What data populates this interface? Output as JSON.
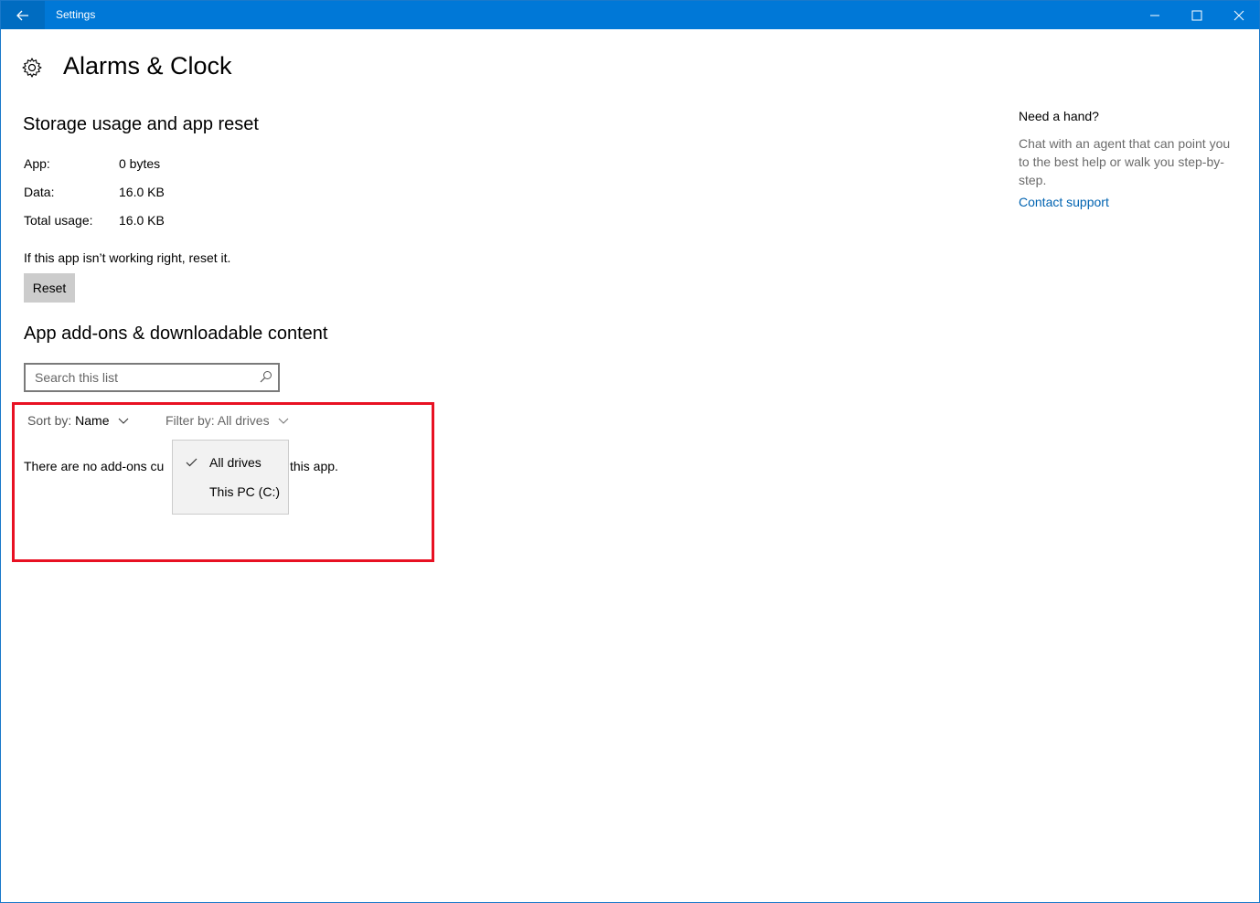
{
  "window": {
    "title": "Settings"
  },
  "page": {
    "title": "Alarms & Clock"
  },
  "storage": {
    "heading": "Storage usage and app reset",
    "rows": [
      {
        "label": "App:",
        "value": "0 bytes"
      },
      {
        "label": "Data:",
        "value": "16.0 KB"
      },
      {
        "label": "Total usage:",
        "value": "16.0 KB"
      }
    ],
    "reset_hint": "If this app isn’t working right, reset it.",
    "reset_label": "Reset"
  },
  "addons": {
    "heading": "App add-ons & downloadable content",
    "search_placeholder": "Search this list",
    "sort_prefix": "Sort by: ",
    "sort_value": "Name",
    "filter_label": "Filter by: All drives",
    "empty_message_left": "There are no add-ons cu",
    "empty_message_right": "this app.",
    "filter_options": [
      {
        "label": "All drives",
        "selected": true
      },
      {
        "label": "This PC (C:)",
        "selected": false
      }
    ]
  },
  "help": {
    "title": "Need a hand?",
    "description": "Chat with an agent that can point you to the best help or walk you step-by-step.",
    "link": "Contact support"
  },
  "colors": {
    "titlebar": "#0078d7",
    "accent_link": "#0063b1",
    "highlight": "#e81123"
  },
  "icons": [
    "back-arrow-icon",
    "minimize-icon",
    "maximize-icon",
    "close-icon",
    "gear-icon",
    "search-icon",
    "chevron-down-icon",
    "checkmark-icon"
  ]
}
